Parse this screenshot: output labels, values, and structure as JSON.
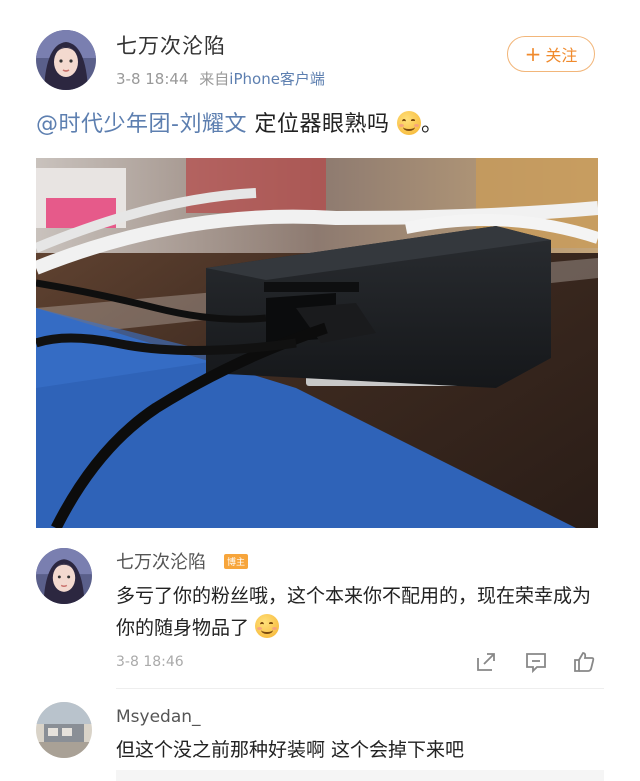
{
  "post": {
    "username": "七万次沦陷",
    "time": "3-8 18:44",
    "source_prefix": "来自",
    "source": "iPhone客户端",
    "follow_label": "关注",
    "mention": "@时代少年团-刘耀文",
    "text": " 定位器眼熟吗",
    "text_end": "。"
  },
  "comments": [
    {
      "username": "七万次沦陷",
      "badge": "博主",
      "text": "多亏了你的粉丝哦，这个本来你不配用的，现在荣幸成为你的随身物品了",
      "time": "3-8 18:46"
    },
    {
      "username": "Msyedan_",
      "text": "但这个没之前那种好装啊 这个会掉下来吧"
    }
  ],
  "icons": {
    "emoji": "smile-emoji",
    "share": "share-icon",
    "comment": "comment-icon",
    "like": "thumbs-up-icon"
  },
  "colors": {
    "link": "#5d7fb0",
    "follow": "#f08a2c",
    "badge": "#f7a53b"
  }
}
